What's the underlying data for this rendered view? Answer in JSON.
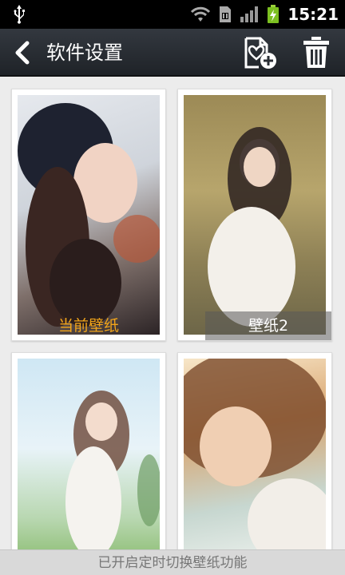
{
  "status_bar": {
    "time": "15:21",
    "icons": [
      "usb-icon",
      "wifi-icon",
      "sim-icon",
      "signal-icon",
      "battery-charging-icon"
    ]
  },
  "header": {
    "title": "软件设置",
    "back_icon": "chevron-left-icon",
    "add_icon": "add-wallpaper-icon",
    "delete_icon": "trash-icon"
  },
  "wallpapers": [
    {
      "label": "当前壁纸",
      "is_current": true
    },
    {
      "label": "壁纸2",
      "is_current": false
    },
    {
      "label": "",
      "is_current": false
    },
    {
      "label": "",
      "is_current": false
    }
  ],
  "footer": {
    "message": "已开启定时切换壁纸功能"
  },
  "colors": {
    "current_label": "#f2a51a",
    "titlebar": "#2a2e34"
  }
}
